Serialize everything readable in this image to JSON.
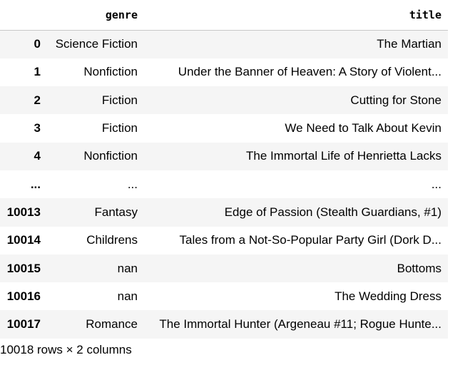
{
  "table": {
    "columns": [
      "",
      "genre",
      "title"
    ],
    "rows": [
      {
        "index": "0",
        "genre": "Science Fiction",
        "title": "The Martian"
      },
      {
        "index": "1",
        "genre": "Nonfiction",
        "title": "Under the Banner of Heaven: A Story of Violent..."
      },
      {
        "index": "2",
        "genre": "Fiction",
        "title": "Cutting for Stone"
      },
      {
        "index": "3",
        "genre": "Fiction",
        "title": "We Need to Talk About Kevin"
      },
      {
        "index": "4",
        "genre": "Nonfiction",
        "title": "The Immortal Life of Henrietta Lacks"
      },
      {
        "index": "...",
        "genre": "...",
        "title": "..."
      },
      {
        "index": "10013",
        "genre": "Fantasy",
        "title": "Edge of Passion (Stealth Guardians, #1)"
      },
      {
        "index": "10014",
        "genre": "Childrens",
        "title": "Tales from a Not-So-Popular Party Girl (Dork D..."
      },
      {
        "index": "10015",
        "genre": "nan",
        "title": "Bottoms"
      },
      {
        "index": "10016",
        "genre": "nan",
        "title": "The Wedding Dress"
      },
      {
        "index": "10017",
        "genre": "Romance",
        "title": "The Immortal Hunter (Argeneau #11; Rogue Hunte..."
      }
    ]
  },
  "footer": "10018 rows × 2 columns"
}
